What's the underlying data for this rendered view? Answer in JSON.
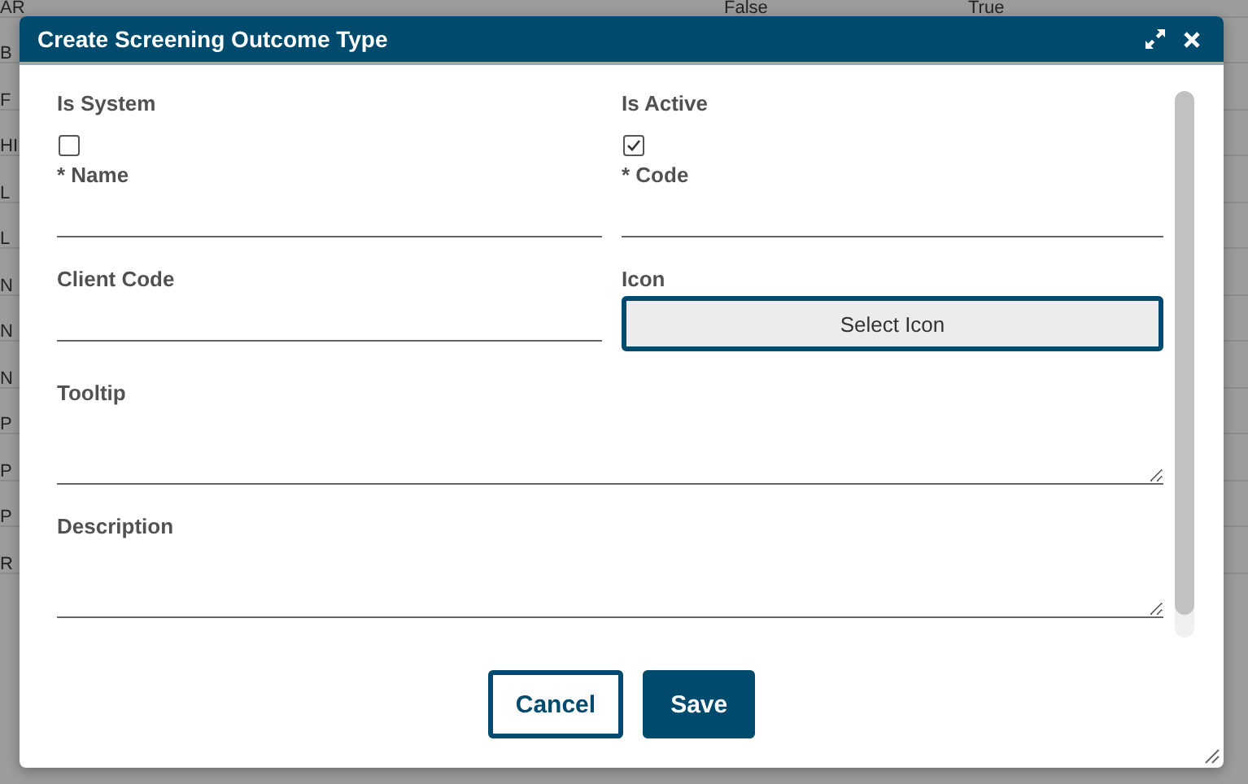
{
  "background_table": {
    "rows": [
      {
        "cells": [
          "AR",
          "False",
          "True"
        ]
      },
      {
        "cells": [
          "B"
        ]
      },
      {
        "cells": [
          "F"
        ]
      },
      {
        "cells": [
          "HI"
        ]
      },
      {
        "cells": [
          "L"
        ]
      },
      {
        "cells": [
          "L"
        ]
      },
      {
        "cells": [
          "N"
        ]
      },
      {
        "cells": [
          "N"
        ]
      },
      {
        "cells": [
          "N"
        ]
      },
      {
        "cells": [
          "P"
        ]
      },
      {
        "cells": [
          "P"
        ]
      },
      {
        "cells": [
          "P"
        ]
      },
      {
        "cells": [
          "R"
        ]
      }
    ]
  },
  "dialog": {
    "title": "Create Screening Outcome Type",
    "fields": [
      {
        "kind": "checkbox",
        "label": "Is System",
        "checked": false
      },
      {
        "kind": "checkbox",
        "label": "Is Active",
        "checked": true
      },
      {
        "kind": "text",
        "label": "* Name"
      },
      {
        "kind": "text",
        "label": "* Code"
      },
      {
        "kind": "text",
        "label": "Client Code"
      },
      {
        "kind": "button",
        "label": "Icon",
        "button": "Select Icon"
      },
      {
        "kind": "textarea",
        "label": "Tooltip"
      },
      {
        "kind": "textarea",
        "label": "Description"
      }
    ],
    "buttons": [
      {
        "label": "Cancel",
        "kind": "secondary"
      },
      {
        "label": "Save",
        "kind": "primary"
      }
    ]
  }
}
